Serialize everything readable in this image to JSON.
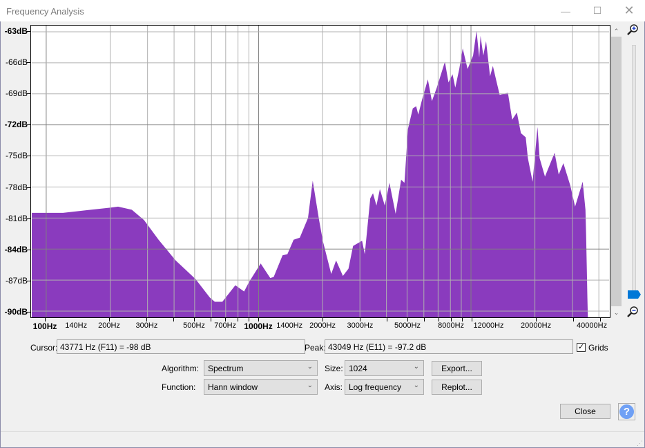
{
  "window": {
    "title": "Frequency Analysis",
    "minimize_icon": "minimize-icon",
    "maximize_icon": "maximize-icon",
    "close_icon": "close-icon"
  },
  "readouts": {
    "cursor_label": "Cursor:",
    "cursor_value": "43771 Hz (F11) = -98 dB",
    "peak_label": "Peak:",
    "peak_value": "43049 Hz (E11) = -97.2 dB",
    "grids_label": "Grids",
    "grids_checked": true
  },
  "controls": {
    "algorithm_label": "Algorithm:",
    "algorithm_value": "Spectrum",
    "size_label": "Size:",
    "size_value": "1024",
    "function_label": "Function:",
    "function_value": "Hann window",
    "axis_label": "Axis:",
    "axis_value": "Log frequency",
    "export_label": "Export...",
    "replot_label": "Replot...",
    "close_label": "Close",
    "help_label": "?"
  },
  "colors": {
    "spectrum": "#8a3bbe",
    "help": "#6fa0f5",
    "slider_thumb": "#0078d7"
  },
  "chart_data": {
    "type": "area",
    "xscale": "log",
    "xlim": [
      85.5,
      44700
    ],
    "ylim": [
      -90.6,
      -62.4
    ],
    "grid": true,
    "yticks": [
      "-63dB",
      "-66dB",
      "-69dB",
      "-72dB",
      "-75dB",
      "-78dB",
      "-81dB",
      "-84dB",
      "-87dB",
      "-90dB"
    ],
    "ytick_values": [
      -63,
      -66,
      -69,
      -72,
      -75,
      -78,
      -81,
      -84,
      -87,
      -90
    ],
    "xticks": [
      "100Hz",
      "140Hz",
      "200Hz",
      "300Hz",
      "500Hz",
      "700Hz",
      "1000Hz",
      "1400Hz",
      "2000Hz",
      "3000Hz",
      "5000Hz",
      "8000Hz",
      "12000Hz",
      "20000Hz",
      "40000Hz"
    ],
    "xtick_values": [
      100,
      140,
      200,
      300,
      500,
      700,
      1000,
      1400,
      2000,
      3000,
      5000,
      8000,
      12000,
      20000,
      40000
    ],
    "series": [
      {
        "points": [
          [
            85.5,
            -80.5
          ],
          [
            120,
            -80.5
          ],
          [
            200,
            -80.0
          ],
          [
            218,
            -79.9
          ],
          [
            253,
            -80.2
          ],
          [
            289,
            -81.2
          ],
          [
            338,
            -83.1
          ],
          [
            407,
            -85.1
          ],
          [
            505,
            -86.9
          ],
          [
            590,
            -88.7
          ],
          [
            622,
            -89.1
          ],
          [
            675,
            -89.1
          ],
          [
            777,
            -87.5
          ],
          [
            855,
            -88.1
          ],
          [
            901,
            -87.2
          ],
          [
            1023,
            -85.4
          ],
          [
            1135,
            -86.8
          ],
          [
            1178,
            -86.7
          ],
          [
            1297,
            -84.6
          ],
          [
            1366,
            -84.5
          ],
          [
            1462,
            -83.1
          ],
          [
            1563,
            -82.9
          ],
          [
            1708,
            -81.0
          ],
          [
            1799,
            -77.4
          ],
          [
            1923,
            -81.1
          ],
          [
            2011,
            -83.3
          ],
          [
            2198,
            -86.4
          ],
          [
            2317,
            -85.1
          ],
          [
            2495,
            -86.6
          ],
          [
            2649,
            -85.9
          ],
          [
            2786,
            -83.7
          ],
          [
            3070,
            -83.2
          ],
          [
            3162,
            -84.5
          ],
          [
            3356,
            -79.1
          ],
          [
            3458,
            -78.6
          ],
          [
            3589,
            -79.8
          ],
          [
            3724,
            -78.2
          ],
          [
            3926,
            -79.8
          ],
          [
            4130,
            -77.6
          ],
          [
            4416,
            -80.6
          ],
          [
            4688,
            -77.3
          ],
          [
            4864,
            -77.6
          ],
          [
            5047,
            -72.4
          ],
          [
            5321,
            -70.4
          ],
          [
            5521,
            -70.2
          ],
          [
            5649,
            -71.0
          ],
          [
            5861,
            -69.7
          ],
          [
            6266,
            -67.6
          ],
          [
            6546,
            -69.7
          ],
          [
            6902,
            -68.4
          ],
          [
            7537,
            -65.9
          ],
          [
            7834,
            -67.9
          ],
          [
            8185,
            -67.1
          ],
          [
            8433,
            -68.4
          ],
          [
            8810,
            -66.6
          ],
          [
            9141,
            -64.6
          ],
          [
            9638,
            -66.6
          ],
          [
            10233,
            -65.3
          ],
          [
            10617,
            -62.9
          ],
          [
            10940,
            -65.5
          ],
          [
            11090,
            -63.4
          ],
          [
            11430,
            -65.3
          ],
          [
            11780,
            -63.9
          ],
          [
            12300,
            -67.3
          ],
          [
            12680,
            -66.3
          ],
          [
            13150,
            -67.7
          ],
          [
            13650,
            -69.1
          ],
          [
            14930,
            -68.9
          ],
          [
            15630,
            -71.5
          ],
          [
            16440,
            -70.8
          ],
          [
            17180,
            -72.8
          ],
          [
            18110,
            -73.2
          ],
          [
            18530,
            -75.2
          ],
          [
            19500,
            -77.5
          ],
          [
            20560,
            -72.2
          ],
          [
            21040,
            -75.2
          ],
          [
            22300,
            -77.0
          ],
          [
            24750,
            -74.7
          ],
          [
            25880,
            -76.8
          ],
          [
            27230,
            -75.7
          ],
          [
            29380,
            -77.9
          ],
          [
            30900,
            -79.9
          ],
          [
            33570,
            -77.5
          ],
          [
            34590,
            -80.2
          ],
          [
            34830,
            -82.5
          ],
          [
            35080,
            -85.7
          ],
          [
            35320,
            -88.7
          ],
          [
            35640,
            -92
          ]
        ]
      }
    ]
  }
}
